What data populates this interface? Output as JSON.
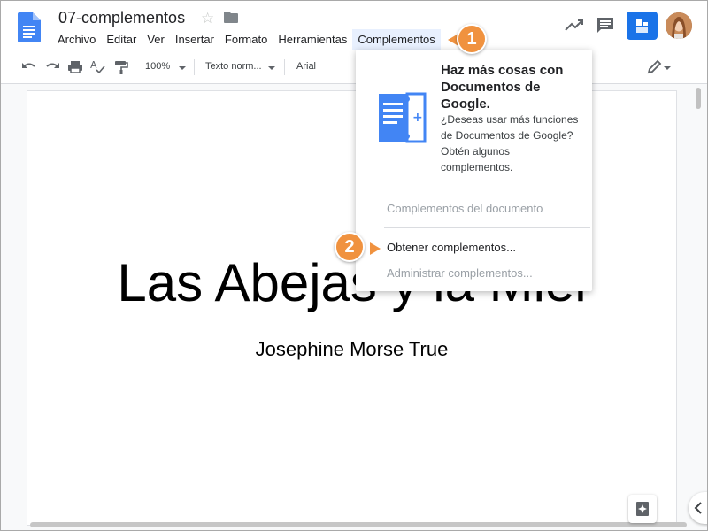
{
  "document": {
    "title": "07-complementos",
    "heading": "Las Abejas y la Miel",
    "subtitle": "Josephine Morse True"
  },
  "menubar": {
    "items": [
      {
        "label": "Archivo"
      },
      {
        "label": "Editar"
      },
      {
        "label": "Ver"
      },
      {
        "label": "Insertar"
      },
      {
        "label": "Formato"
      },
      {
        "label": "Herramientas"
      },
      {
        "label": "Complementos",
        "active": true
      }
    ]
  },
  "toolbar": {
    "zoom": "100%",
    "style": "Texto norm...",
    "font": "Arial"
  },
  "dropdown": {
    "promo_title": "Haz más cosas con Documentos de Google.",
    "promo_body": "¿Deseas usar más funciones de Documentos de Google? Obtén algunos complementos.",
    "items": [
      {
        "label": "Complementos del documento",
        "enabled": false
      },
      {
        "label": "Obtener complementos...",
        "enabled": true
      },
      {
        "label": "Administrar complementos...",
        "enabled": false
      }
    ]
  },
  "callouts": {
    "step1": "1",
    "step2": "2"
  },
  "icons": {
    "doc_logo": "google-docs-icon",
    "star": "star-icon",
    "folder": "folder-icon",
    "trend": "activity-trend-icon",
    "comment": "comment-icon",
    "meet": "meet-present-icon",
    "undo": "undo-icon",
    "redo": "redo-icon",
    "print": "print-icon",
    "spell": "spellcheck-icon",
    "paint": "paint-format-icon",
    "edit_mode": "pencil-icon",
    "explore": "explore-icon",
    "collapse": "chevron-left-icon"
  },
  "colors": {
    "accent": "#1a73e8",
    "callout": "#f0923f",
    "menu_active": "#e8f0fe"
  }
}
